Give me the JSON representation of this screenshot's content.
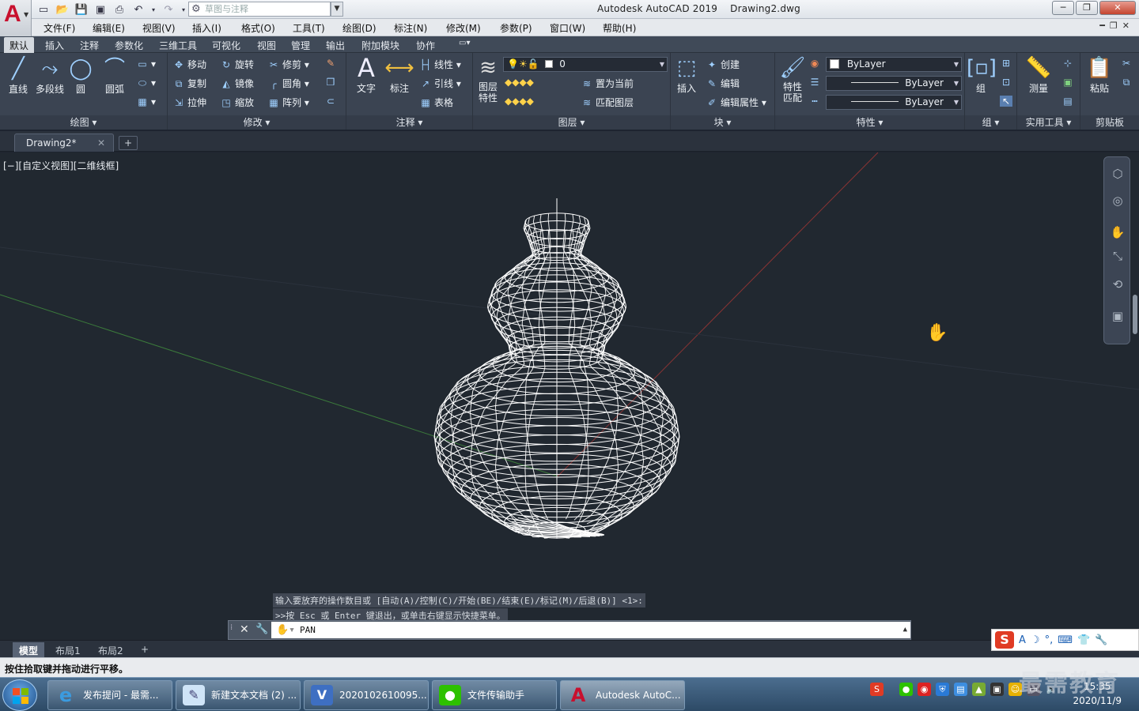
{
  "titlebar": {
    "title": "Autodesk AutoCAD 2019    Drawing2.dwg",
    "workspace_placeholder": "草图与注释",
    "logo": "A"
  },
  "menubar": [
    "文件(F)",
    "编辑(E)",
    "视图(V)",
    "插入(I)",
    "格式(O)",
    "工具(T)",
    "绘图(D)",
    "标注(N)",
    "修改(M)",
    "参数(P)",
    "窗口(W)",
    "帮助(H)"
  ],
  "ribbon_tabs": [
    "默认",
    "插入",
    "注释",
    "参数化",
    "三维工具",
    "可视化",
    "视图",
    "管理",
    "输出",
    "附加模块",
    "协作"
  ],
  "ribbon": {
    "draw": {
      "title": "绘图",
      "line": "直线",
      "polyline": "多段线",
      "circle": "圆",
      "arc": "圆弧"
    },
    "modify": {
      "title": "修改",
      "move": "移动",
      "rotate": "旋转",
      "trim": "修剪",
      "copy": "复制",
      "mirror": "镜像",
      "fillet": "圆角",
      "stretch": "拉伸",
      "scale": "缩放",
      "array": "阵列"
    },
    "annotation": {
      "title": "注释",
      "text": "文字",
      "dimension": "标注",
      "linear": "线性",
      "leader": "引线",
      "table": "表格"
    },
    "layers": {
      "title": "图层",
      "layer_props": "图层\n特性",
      "layer_name": "0",
      "set_current": "置为当前",
      "match_layer": "匹配图层"
    },
    "block": {
      "title": "块",
      "insert": "插入",
      "create": "创建",
      "edit": "编辑",
      "edit_attr": "编辑属性"
    },
    "properties": {
      "title": "特性",
      "match": "特性\n匹配",
      "color": "ByLayer",
      "linetype": "ByLayer",
      "lineweight": "ByLayer"
    },
    "groups": {
      "title": "组",
      "group": "组"
    },
    "utilities": {
      "title": "实用工具",
      "measure": "测量"
    },
    "clipboard": {
      "title": "剪贴板",
      "paste": "粘贴"
    }
  },
  "document_tab": "Drawing2*",
  "viewport": {
    "label": "[−][自定义视图][二维线框]",
    "background": "#212830",
    "wire_color": "#ffffff"
  },
  "command": {
    "history": [
      "输入要放弃的操作数目或 [自动(A)/控制(C)/开始(BE)/结束(E)/标记(M)/后退(B)] <1>:",
      ">>按 Esc 或 Enter 键退出，或单击右键显示快捷菜单。"
    ],
    "current": "PAN"
  },
  "layout_tabs": [
    "模型",
    "布局1",
    "布局2"
  ],
  "status_text": "按住拾取键并拖动进行平移。",
  "taskbar": {
    "items": [
      {
        "label": "发布提问 - 最需...",
        "icon": "ie-icon"
      },
      {
        "label": "新建文本文档 (2) ...",
        "icon": "notepad-icon"
      },
      {
        "label": "2020102610095...",
        "icon": "visio-icon"
      },
      {
        "label": "文件传输助手",
        "icon": "wechat-icon"
      },
      {
        "label": "Autodesk AutoC...",
        "icon": "autocad-icon"
      }
    ],
    "clock_time": "15:35",
    "clock_date": "2020/11/9"
  },
  "watermark": "最需教育"
}
